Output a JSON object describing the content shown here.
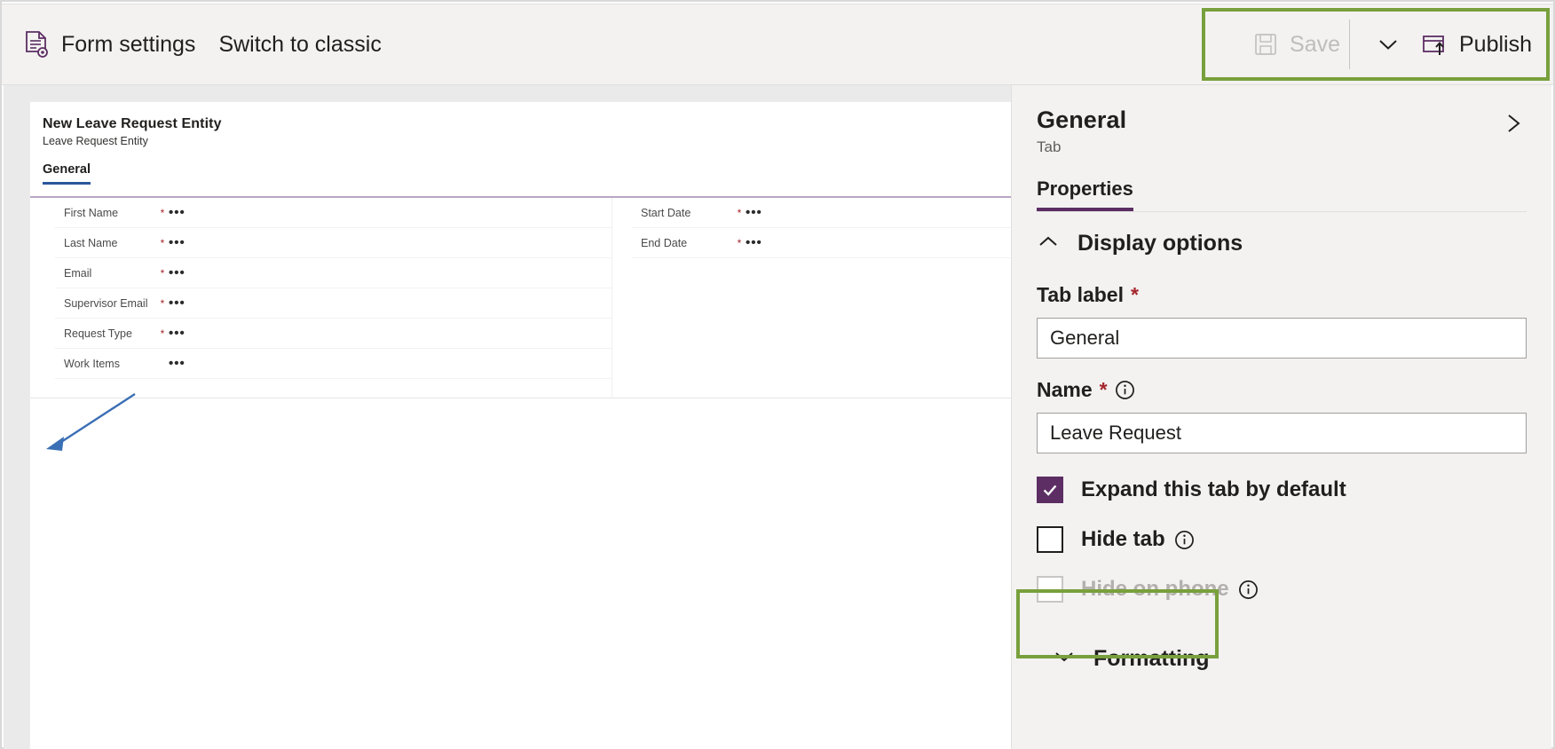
{
  "commandbar": {
    "form_settings": "Form settings",
    "switch_to_classic": "Switch to classic",
    "save": "Save",
    "publish": "Publish"
  },
  "canvas": {
    "form_title": "New Leave Request Entity",
    "form_subtitle": "Leave Request Entity",
    "tab_label": "General",
    "left_fields": [
      {
        "label": "First Name",
        "required": "*",
        "dots": "•••"
      },
      {
        "label": "Last Name",
        "required": "*",
        "dots": "•••"
      },
      {
        "label": "Email",
        "required": "*",
        "dots": "•••"
      },
      {
        "label": "Supervisor Email",
        "required": "*",
        "dots": "•••"
      },
      {
        "label": "Request Type",
        "required": "*",
        "dots": "•••"
      },
      {
        "label": "Work Items",
        "required": "",
        "dots": "•••"
      }
    ],
    "right_fields": [
      {
        "label": "Start Date",
        "required": "*",
        "dots": "•••"
      },
      {
        "label": "End Date",
        "required": "*",
        "dots": "•••"
      }
    ]
  },
  "properties": {
    "title": "General",
    "subtitle": "Tab",
    "tab_properties": "Properties",
    "display_options": "Display options",
    "tab_label_field": {
      "label": "Tab label",
      "required": "*",
      "value": "General"
    },
    "name_field": {
      "label": "Name",
      "required": "*",
      "value": "Leave Request"
    },
    "checkboxes": [
      {
        "label": "Expand this tab by default",
        "checked": true,
        "disabled": false,
        "has_info": false
      },
      {
        "label": "Hide tab",
        "checked": false,
        "disabled": false,
        "has_info": true
      },
      {
        "label": "Hide on phone",
        "checked": false,
        "disabled": true,
        "has_info": true
      }
    ],
    "formatting": "Formatting"
  },
  "colors": {
    "accent_purple": "#5c2e63",
    "highlight_green": "#78a03c",
    "tab_underline_blue": "#2b579a",
    "required_red": "#a4262c",
    "arrow_blue": "#3b6fb5",
    "panel_bg": "#f3f2f1"
  }
}
